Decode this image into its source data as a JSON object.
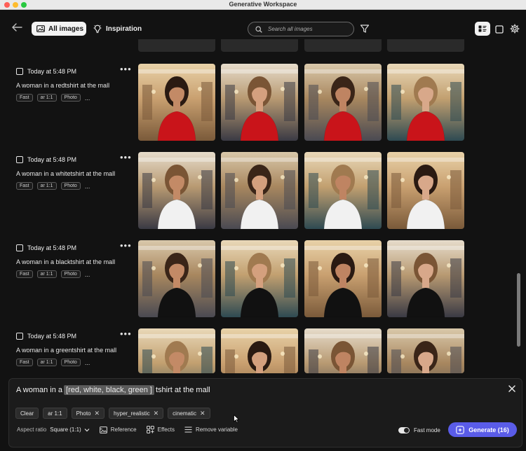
{
  "window": {
    "title": "Generative Workspace"
  },
  "toolbar": {
    "tab_all_images": "All images",
    "tab_inspiration": "Inspiration",
    "search_placeholder": "Search all images"
  },
  "groups": [
    {
      "date": "Today at 5:48 PM",
      "prompt": "A woman in a redtshirt at the mall",
      "tags": [
        "Fast",
        "ar 1:1",
        "Photo"
      ],
      "more": "...",
      "shirt_color": "#c9141a"
    },
    {
      "date": "Today at 5:48 PM",
      "prompt": "A woman in a whitetshirt at the mall",
      "tags": [
        "Fast",
        "ar 1:1",
        "Photo"
      ],
      "more": "...",
      "shirt_color": "#f1f1f1"
    },
    {
      "date": "Today at 5:48 PM",
      "prompt": "A woman in a blacktshirt at the mall",
      "tags": [
        "Fast",
        "ar 1:1",
        "Photo"
      ],
      "more": "...",
      "shirt_color": "#111111"
    },
    {
      "date": "Today at 5:48 PM",
      "prompt": "A woman in a greentshirt at the mall",
      "tags": [
        "Fast",
        "ar 1:1",
        "Photo"
      ],
      "more": "...",
      "shirt_color": "#1f8a3c"
    }
  ],
  "panel": {
    "prompt_prefix": "A woman in a",
    "prompt_variable": "[red, white, black, green ]",
    "prompt_suffix": "tshirt at the mall",
    "chips": [
      {
        "label": "Clear",
        "removable": false
      },
      {
        "label": "ar 1:1",
        "removable": false
      },
      {
        "label": "Photo",
        "removable": true
      },
      {
        "label": "hyper_realistic",
        "removable": true
      },
      {
        "label": "cinematic",
        "removable": true
      }
    ],
    "aspect_ratio_label": "Aspect ratio",
    "aspect_ratio_value": "Square (1:1)",
    "reference_label": "Reference",
    "effects_label": "Effects",
    "remove_variable_label": "Remove variable",
    "fast_mode_label": "Fast mode",
    "generate_label": "Generate (16)"
  },
  "colors": {
    "accent": "#5a5ce8",
    "background": "#121212"
  }
}
